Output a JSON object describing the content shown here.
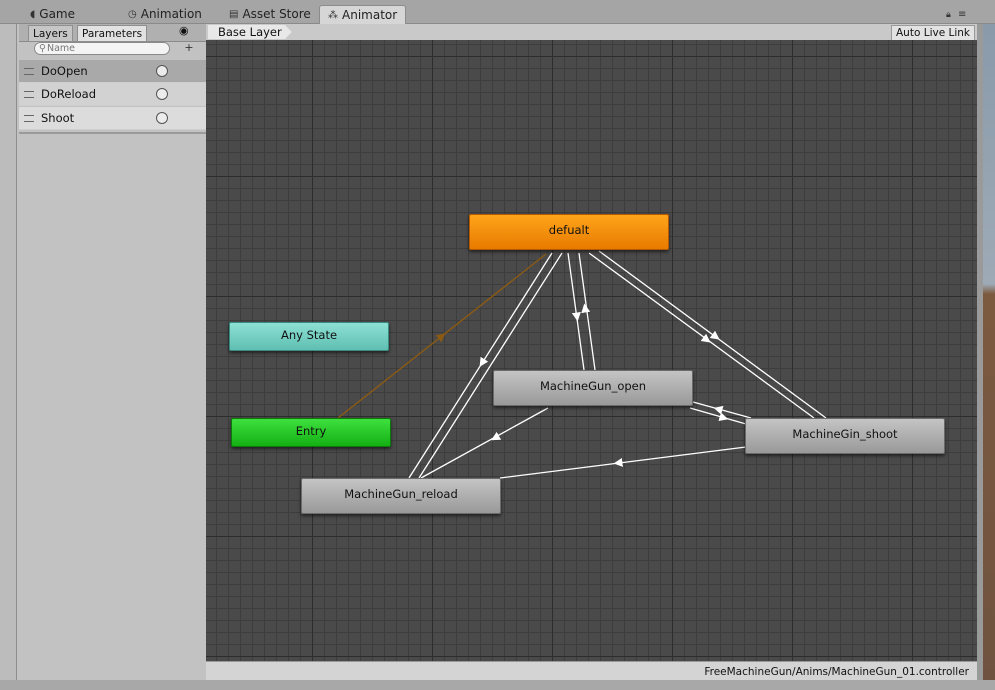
{
  "tabs": [
    {
      "label": "Game",
      "icon": "pacman-icon"
    },
    {
      "label": "Animation",
      "icon": "clock-icon"
    },
    {
      "label": "Asset Store",
      "icon": "bag-icon"
    },
    {
      "label": "Animator",
      "icon": "animator-icon"
    }
  ],
  "params_panel": {
    "tab_layers": "Layers",
    "tab_parameters": "Parameters",
    "search_placeholder": "Name",
    "items": [
      {
        "name": "DoOpen"
      },
      {
        "name": "DoReload"
      },
      {
        "name": "Shoot"
      }
    ]
  },
  "toolbar": {
    "breadcrumb": "Base Layer",
    "auto_live_link": "Auto Live Link"
  },
  "states": {
    "default": "defualt",
    "any_state": "Any State",
    "entry": "Entry",
    "open": "MachineGun_open",
    "shoot": "MachineGin_shoot",
    "reload": "MachineGun_reload"
  },
  "status": {
    "path": "FreeMachineGun/Anims/MachineGun_01.controller"
  }
}
